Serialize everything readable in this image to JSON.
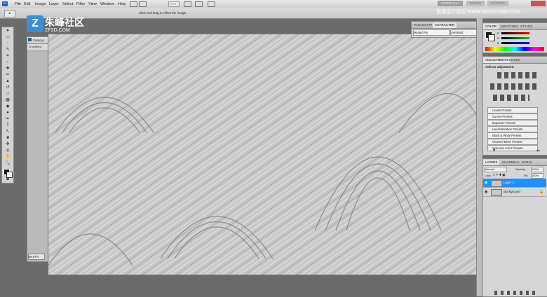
{
  "menu": [
    "File",
    "Edit",
    "Image",
    "Layer",
    "Select",
    "Filter",
    "View",
    "Window",
    "Help"
  ],
  "options": {
    "hint": "Click and drag to offset the image.",
    "zoom": "100%"
  },
  "workspace": [
    "ESSENTIALS",
    "DESIGN",
    "PAINTING"
  ],
  "watermark": {
    "left_text": "朱峰社区",
    "left_url": "ZF3D.COM",
    "right_text": "思缘设计论坛 WWW.MISSYUAN.COM"
  },
  "document": {
    "tab": "training c",
    "tab2": "Di untitled",
    "zoom": "66.67%"
  },
  "character_panel": {
    "tabs": [
      "PARAGRAPH",
      "CHARACTER"
    ],
    "font": "Myriad Pro",
    "style": "Semibold"
  },
  "color_panel": {
    "tabs": [
      "COLOR",
      "SWATCHES",
      "STYLES"
    ],
    "channels": [
      "R",
      "G",
      "B"
    ]
  },
  "adjustments": {
    "tabs": [
      "ADJUSTMENTS",
      "MASKS"
    ],
    "title": "Add an adjustment",
    "presets": [
      "Levels Presets",
      "Curves Presets",
      "Exposure Presets",
      "Hue/Saturation Presets",
      "Black & White Presets",
      "Channel Mixer Presets",
      "Selective Color Presets"
    ]
  },
  "layers": {
    "tabs": [
      "LAYERS",
      "CHANNELS",
      "PATHS"
    ],
    "blend": "Normal",
    "opacity_label": "Opacity:",
    "opacity": "100%",
    "lock_label": "Lock:",
    "fill_label": "Fill:",
    "fill": "100%",
    "items": [
      {
        "name": "Layer 1",
        "selected": true
      },
      {
        "name": "Background",
        "selected": false
      }
    ]
  },
  "colors": {
    "selection": "#1e90ff",
    "canvas": "#c9c9c9"
  }
}
